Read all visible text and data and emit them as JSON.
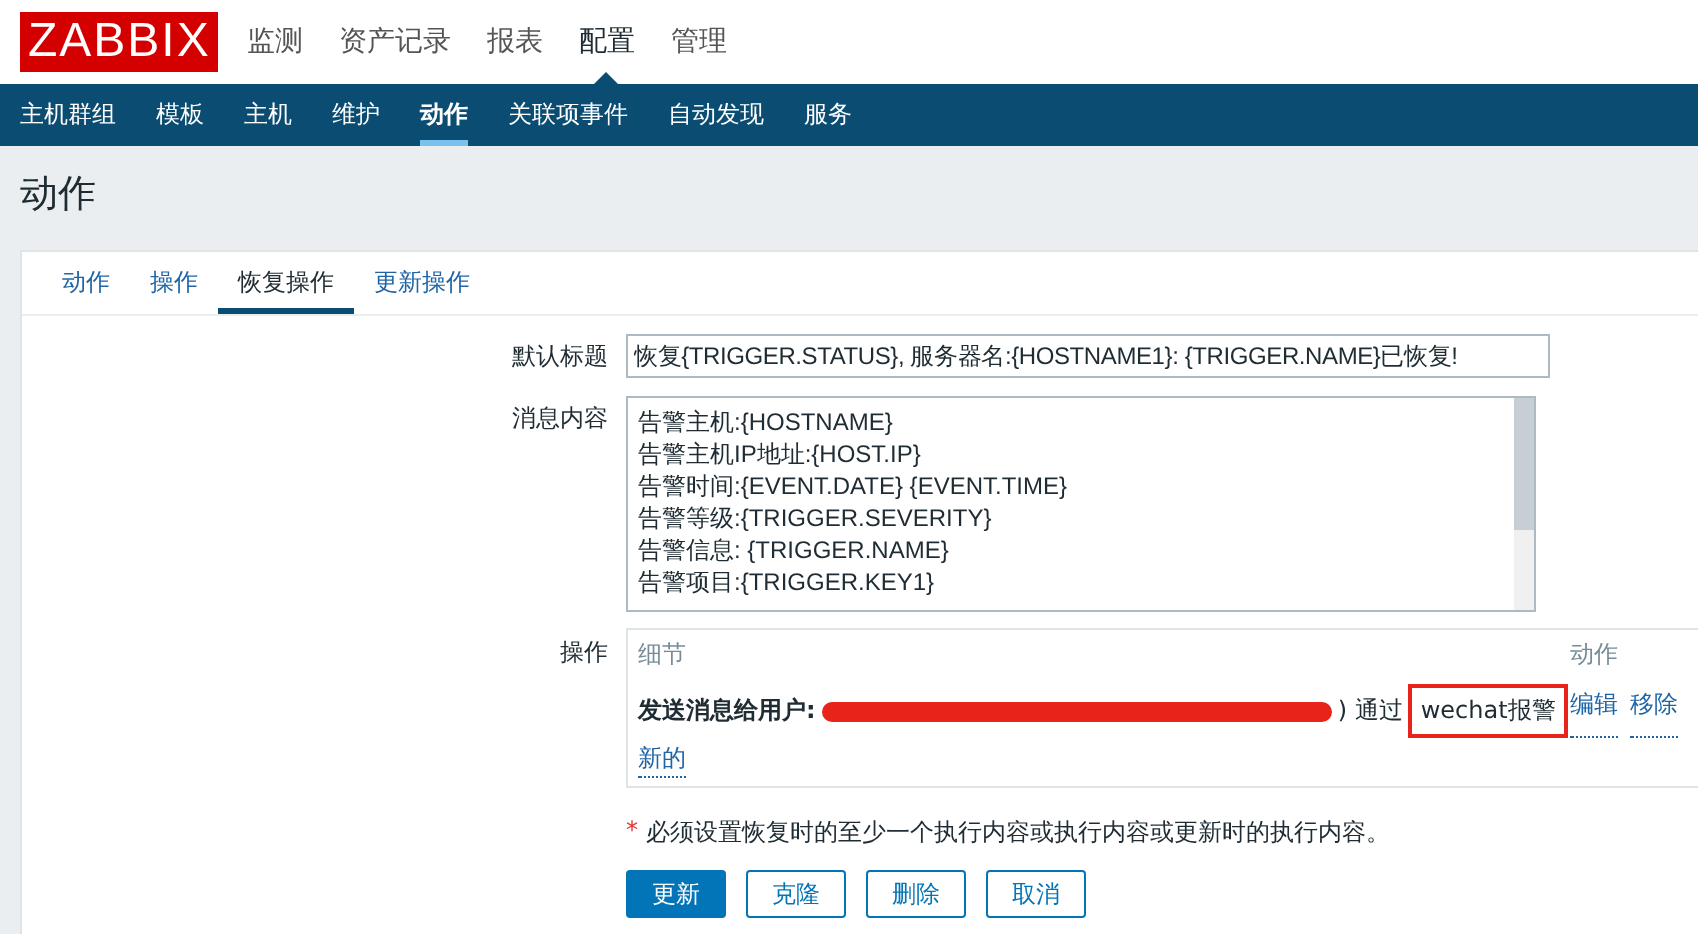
{
  "logo": "ZABBIX",
  "main_menu": [
    {
      "label": "监测",
      "selected": false
    },
    {
      "label": "资产记录",
      "selected": false
    },
    {
      "label": "报表",
      "selected": false
    },
    {
      "label": "配置",
      "selected": true
    },
    {
      "label": "管理",
      "selected": false
    }
  ],
  "sub_menu": [
    {
      "label": "主机群组",
      "selected": false
    },
    {
      "label": "模板",
      "selected": false
    },
    {
      "label": "主机",
      "selected": false
    },
    {
      "label": "维护",
      "selected": false
    },
    {
      "label": "动作",
      "selected": true
    },
    {
      "label": "关联项事件",
      "selected": false
    },
    {
      "label": "自动发现",
      "selected": false
    },
    {
      "label": "服务",
      "selected": false
    }
  ],
  "page_title": "动作",
  "tabs": [
    {
      "label": "动作",
      "selected": false
    },
    {
      "label": "操作",
      "selected": false
    },
    {
      "label": "恢复操作",
      "selected": true
    },
    {
      "label": "更新操作",
      "selected": false
    }
  ],
  "form": {
    "subject_label": "默认标题",
    "subject_value": "恢复{TRIGGER.STATUS}, 服务器名:{HOSTNAME1}: {TRIGGER.NAME}已恢复!",
    "message_label": "消息内容",
    "message_lines": [
      "告警主机:{HOSTNAME}",
      "告警主机IP地址:{HOST.IP}",
      "告警时间:{EVENT.DATE} {EVENT.TIME}",
      "告警等级:{TRIGGER.SEVERITY}",
      "告警信息: {TRIGGER.NAME}",
      "告警项目:{TRIGGER.KEY1}"
    ],
    "operations_label": "操作",
    "operations": {
      "columns": [
        "细节",
        "动作"
      ],
      "rows": [
        {
          "detail_bold": "发送消息给用户:",
          "detail_suffix": ") 通过",
          "media": "wechat报警",
          "highlighted": true,
          "actions": [
            "编辑",
            "移除"
          ]
        }
      ],
      "new_link": "新的"
    },
    "note_mark": "*",
    "note": "必须设置恢复时的至少一个执行内容或执行内容或更新时的执行内容。",
    "buttons": [
      {
        "label": "更新",
        "kind": "primary"
      },
      {
        "label": "克隆",
        "kind": "secondary"
      },
      {
        "label": "删除",
        "kind": "secondary"
      },
      {
        "label": "取消",
        "kind": "secondary"
      }
    ]
  }
}
